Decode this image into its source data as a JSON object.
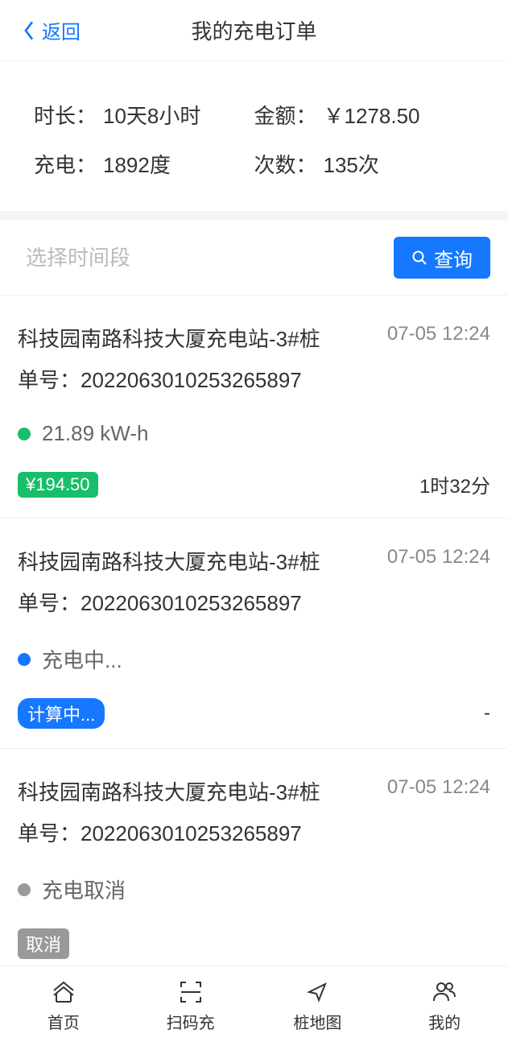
{
  "navbar": {
    "back_label": "返回",
    "title": "我的充电订单"
  },
  "summary": {
    "duration_label": "时长：",
    "duration_value": "10天8小时",
    "amount_label": "金额：",
    "amount_value": "￥1278.50",
    "energy_label": "充电：",
    "energy_value": "1892度",
    "count_label": "次数：",
    "count_value": "135次"
  },
  "search": {
    "placeholder": "选择时间段",
    "query_label": "查询"
  },
  "orders": [
    {
      "station": "科技园南路科技大厦充电站-3#桩",
      "time": "07-05 12:24",
      "order_no_label": "单号：",
      "order_no": "2022063010253265897",
      "status_color": "green",
      "status_text": "21.89 kW-h",
      "badge_color": "green",
      "badge_text": "¥194.50",
      "duration": "1时32分"
    },
    {
      "station": "科技园南路科技大厦充电站-3#桩",
      "time": "07-05 12:24",
      "order_no_label": "单号：",
      "order_no": "2022063010253265897",
      "status_color": "blue",
      "status_text": "充电中...",
      "badge_color": "blue",
      "badge_text": "计算中...",
      "duration": "-"
    },
    {
      "station": "科技园南路科技大厦充电站-3#桩",
      "time": "07-05 12:24",
      "order_no_label": "单号：",
      "order_no": "2022063010253265897",
      "status_color": "gray",
      "status_text": "充电取消",
      "badge_color": "gray",
      "badge_text": "取消",
      "duration": ""
    }
  ],
  "tabbar": {
    "home": "首页",
    "scan": "扫码充",
    "map": "桩地图",
    "mine": "我的"
  }
}
